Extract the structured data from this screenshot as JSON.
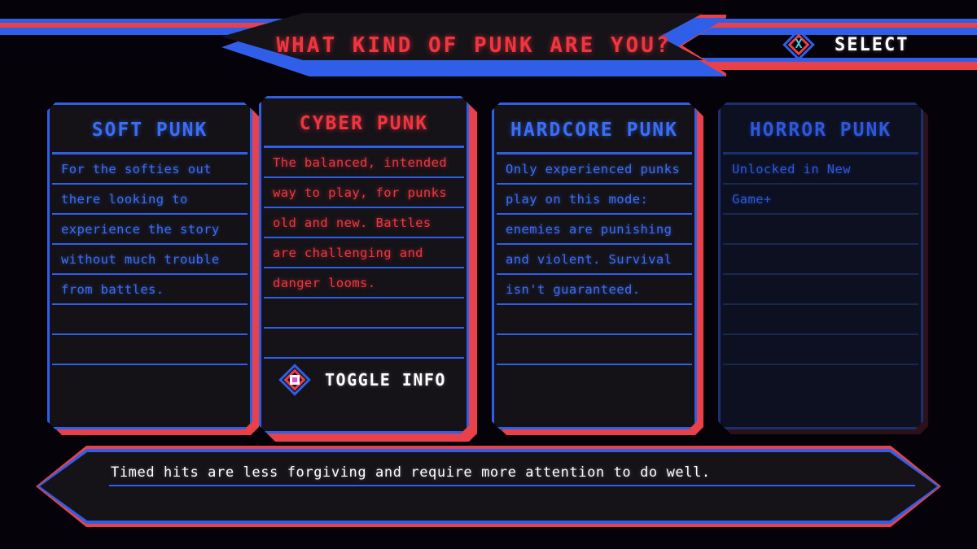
{
  "header": {
    "title": "WHAT KIND OF PUNK ARE YOU?",
    "select_hint": {
      "label": "SELECT",
      "icon": "button-x-icon",
      "glyph": "X"
    },
    "accent_blue": "#2f5fe8",
    "accent_red": "#e8414a"
  },
  "cards": [
    {
      "id": "soft-punk",
      "title": "SOFT PUNK",
      "state": "available",
      "lines": [
        "For the softies out",
        "there looking to",
        "experience the story",
        "without much trouble",
        "from battles.",
        "",
        "",
        ""
      ]
    },
    {
      "id": "cyber-punk",
      "title": "CYBER PUNK",
      "state": "selected",
      "lines": [
        "The balanced, intended",
        "way to play, for punks",
        "old and new. Battles",
        "are challenging and",
        "danger looms.",
        "",
        ""
      ],
      "toggle": {
        "label": "TOGGLE INFO",
        "icon": "button-square-icon"
      }
    },
    {
      "id": "hardcore-punk",
      "title": "HARDCORE PUNK",
      "state": "available",
      "lines": [
        "Only experienced punks",
        "play on this mode:",
        "enemies are punishing",
        "and violent. Survival",
        "isn't guaranteed.",
        "",
        "",
        ""
      ]
    },
    {
      "id": "horror-punk",
      "title": "HORROR PUNK",
      "state": "locked",
      "lines": [
        "Unlocked in New",
        "Game+",
        "",
        "",
        "",
        "",
        "",
        ""
      ]
    }
  ],
  "status_bar": {
    "text": "Timed hits are less forgiving and require more attention to do well."
  }
}
